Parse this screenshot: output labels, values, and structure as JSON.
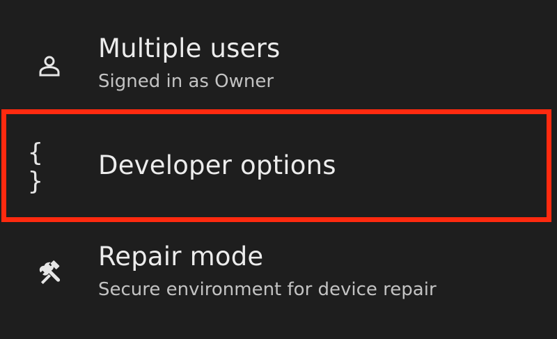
{
  "settings": {
    "items": [
      {
        "title": "Multiple users",
        "subtitle": "Signed in as Owner",
        "icon": "person-icon"
      },
      {
        "title": "Developer options",
        "subtitle": "",
        "icon": "braces-icon",
        "icon_glyph": "{ }"
      },
      {
        "title": "Repair mode",
        "subtitle": "Secure environment for device repair",
        "icon": "repair-tools-icon"
      }
    ]
  },
  "highlight": {
    "color": "#ff2a0f",
    "target": "Developer options"
  },
  "colors": {
    "background": "#1e1e1e",
    "title_text": "#ececec",
    "subtitle_text": "#c3c3c3",
    "icon": "#e6e6e6"
  }
}
